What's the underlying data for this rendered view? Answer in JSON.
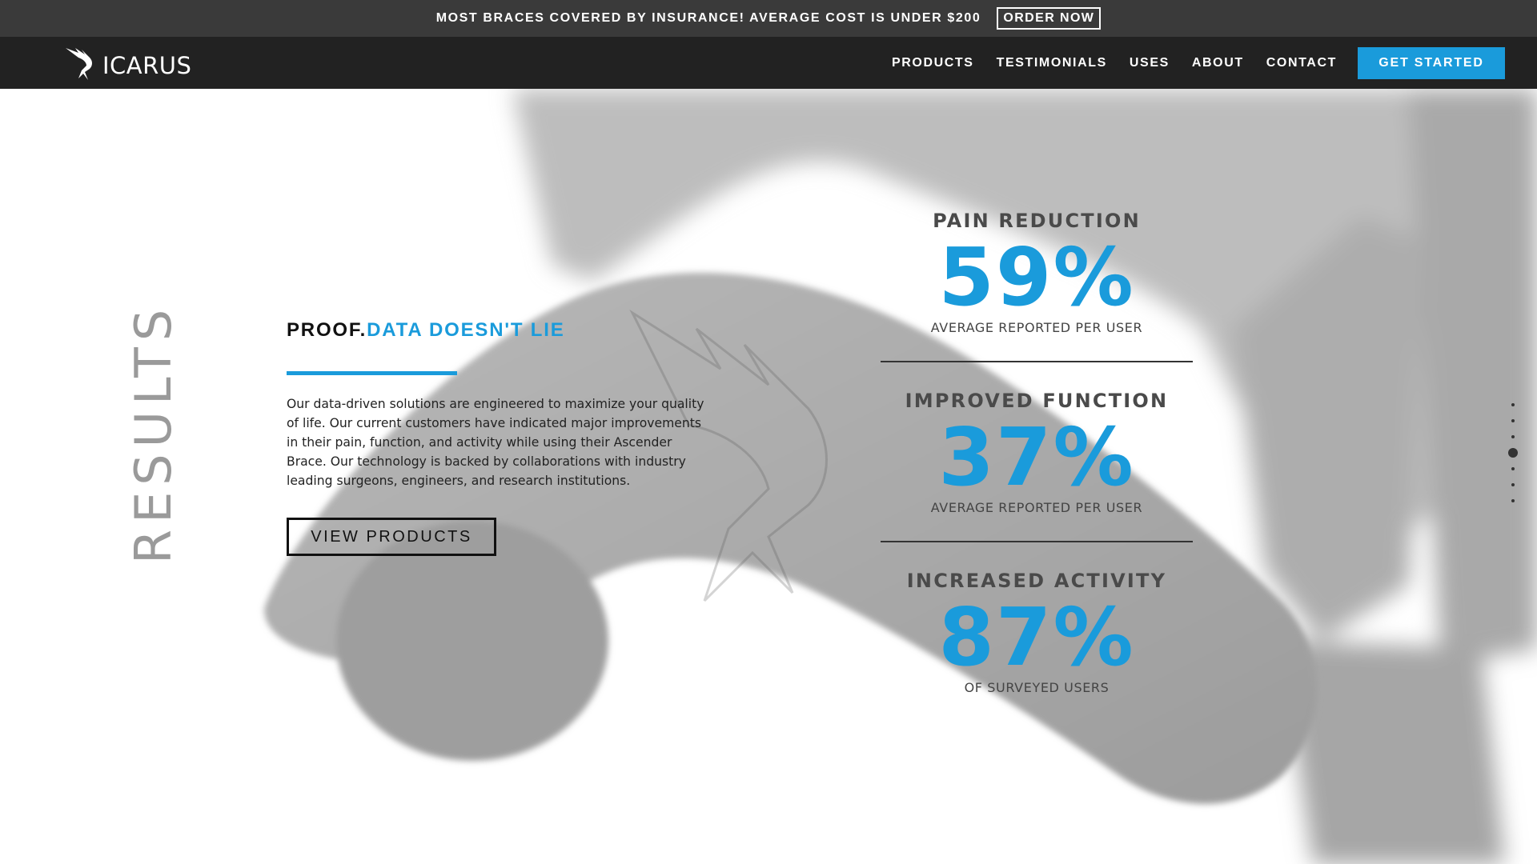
{
  "promo": {
    "text": "MOST BRACES COVERED BY INSURANCE! AVERAGE COST IS UNDER $200",
    "button": "ORDER NOW"
  },
  "nav": {
    "logo_text": "ICARUS",
    "logo_icon": "winged-figure-icon",
    "links": [
      "PRODUCTS",
      "TESTIMONIALS",
      "USES",
      "ABOUT",
      "CONTACT"
    ],
    "cta": "GET STARTED"
  },
  "section": {
    "side_title": "RESULTS",
    "heading_prefix": "PROOF.",
    "heading_accent": "DATA DOESN'T LIE",
    "body": "Our data-driven solutions are engineered to maximize your quality of life. Our current customers have indicated major improvements in their pain, function, and activity while using their Ascender Brace. Our technology is backed by collaborations with industry leading surgeons, engineers, and research institutions.",
    "button": "VIEW PRODUCTS"
  },
  "stats": [
    {
      "label": "PAIN REDUCTION",
      "value": "59%",
      "sub": "AVERAGE REPORTED PER USER"
    },
    {
      "label": "IMPROVED FUNCTION",
      "value": "37%",
      "sub": "AVERAGE REPORTED PER USER"
    },
    {
      "label": "INCREASED ACTIVITY",
      "value": "87%",
      "sub": "OF SURVEYED USERS"
    }
  ],
  "page_dots": {
    "count": 7,
    "active_index": 3
  },
  "colors": {
    "accent": "#1a9bdb",
    "promo_bg": "#3a3a3a",
    "nav_bg": "#222222"
  }
}
